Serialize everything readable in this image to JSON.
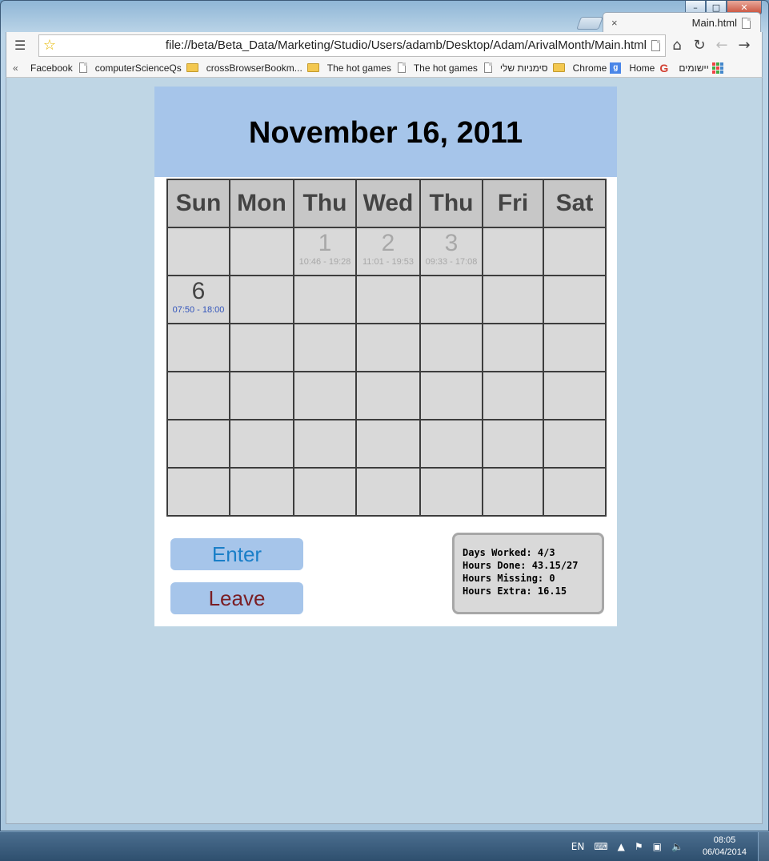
{
  "browser": {
    "tab_title": "Main.html",
    "tab_close": "×",
    "url": "file://beta/Beta_Data/Marketing/Studio/Users/adamb/Desktop/Adam/ArivalMonth/Main.html",
    "menu_icon": "☰",
    "star_icon": "☆",
    "home_icon": "⌂",
    "reload_icon": "↻",
    "back_icon": "←",
    "forward_icon": "→",
    "caption": {
      "minimize": "–",
      "maximize": "□",
      "close": "✕"
    },
    "bookmarks": {
      "chevron": "«",
      "items": [
        {
          "label": "Facebook",
          "icon": "doc-icon"
        },
        {
          "label": "computerScienceQs",
          "icon": "folder-icon"
        },
        {
          "label": "crossBrowserBookm...",
          "icon": "folder-icon"
        },
        {
          "label": "The hot games",
          "icon": "doc-icon"
        },
        {
          "label": "The hot games",
          "icon": "doc-icon"
        },
        {
          "label": "סימניות שלי",
          "icon": "folder-icon"
        },
        {
          "label": "Chrome",
          "icon": "g-icon"
        },
        {
          "label": "Home",
          "icon": "gmail-icon"
        },
        {
          "label": "יישומים",
          "icon": "apps-icon"
        }
      ]
    }
  },
  "app": {
    "title": "November 16, 2011",
    "weekdays": [
      "Sun",
      "Mon",
      "Thu",
      "Wed",
      "Thu",
      "Fri",
      "Sat"
    ],
    "days": {
      "d1": {
        "num": "1",
        "hours": "10:46 - 19:28"
      },
      "d2": {
        "num": "2",
        "hours": "11:01 - 19:53"
      },
      "d3": {
        "num": "3",
        "hours": "09:33 - 17:08"
      },
      "d6": {
        "num": "6",
        "hours": "07:50 - 18:00"
      }
    },
    "enter_label": "Enter",
    "leave_label": "Leave",
    "stats": {
      "days_worked": "Days Worked: 4/3",
      "hours_done": "Hours Done: 43.15/27",
      "hours_missing": "Hours Missing: 0",
      "hours_extra": "Hours Extra: 16.15"
    }
  },
  "taskbar": {
    "language": "EN",
    "time": "08:05",
    "date": "06/04/2014"
  }
}
